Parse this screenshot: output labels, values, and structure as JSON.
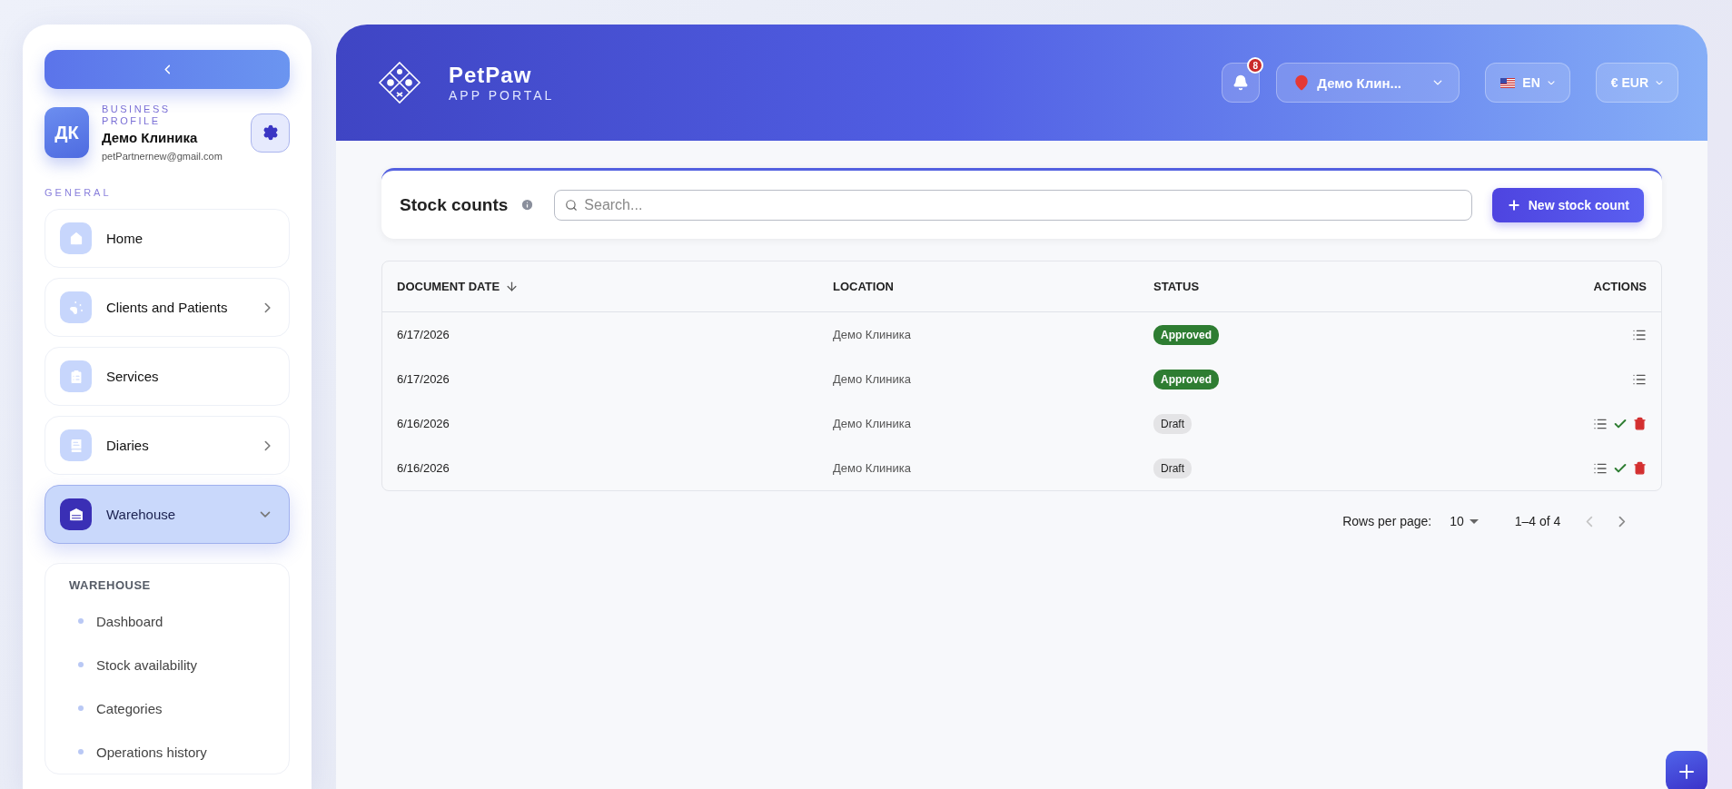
{
  "sidebar": {
    "profile": {
      "initials": "ДК",
      "caption": "BUSINESS PROFILE",
      "name": "Демо Клиника",
      "email": "petPartnernew@gmail.com"
    },
    "section_title": "GENERAL",
    "items": [
      {
        "label": "Home",
        "kind": "link",
        "selected": false
      },
      {
        "label": "Clients and Patients",
        "kind": "group",
        "expanded": false,
        "selected": false
      },
      {
        "label": "Services",
        "kind": "link",
        "selected": false
      },
      {
        "label": "Diaries",
        "kind": "group",
        "expanded": false,
        "selected": false
      },
      {
        "label": "Warehouse",
        "kind": "group",
        "expanded": true,
        "selected": true,
        "submenu_title": "WAREHOUSE",
        "children": [
          {
            "label": "Dashboard"
          },
          {
            "label": "Stock availability"
          },
          {
            "label": "Categories"
          },
          {
            "label": "Operations history"
          }
        ]
      }
    ]
  },
  "header": {
    "brand": "PetPaw",
    "subtitle": "APP PORTAL",
    "notifications": "8",
    "location": "Демо Клин...",
    "language": "EN",
    "currency": "€ EUR"
  },
  "toolbar": {
    "title": "Stock counts",
    "search": {
      "placeholder": "Search..."
    },
    "new_button": "New stock count"
  },
  "table": {
    "columns": [
      {
        "label": "DOCUMENT DATE",
        "sorted": true
      },
      {
        "label": "LOCATION",
        "sorted": false
      },
      {
        "label": "STATUS",
        "sorted": false
      },
      {
        "label": "ACTIONS",
        "sorted": false
      }
    ],
    "rows": [
      {
        "date": "6/17/2026",
        "location": "Демо Клиника",
        "status": {
          "label": "Approved",
          "kind": "approved"
        },
        "actions": [
          {
            "kind": "details"
          }
        ]
      },
      {
        "date": "6/17/2026",
        "location": "Демо Клиника",
        "status": {
          "label": "Approved",
          "kind": "approved"
        },
        "actions": [
          {
            "kind": "details"
          }
        ]
      },
      {
        "date": "6/16/2026",
        "location": "Демо Клиника",
        "status": {
          "label": "Draft",
          "kind": "draft"
        },
        "actions": [
          {
            "kind": "details"
          },
          {
            "kind": "approve"
          },
          {
            "kind": "delete"
          }
        ]
      },
      {
        "date": "6/16/2026",
        "location": "Демо Клиника",
        "status": {
          "label": "Draft",
          "kind": "draft"
        },
        "actions": [
          {
            "kind": "details"
          },
          {
            "kind": "approve"
          },
          {
            "kind": "delete"
          }
        ]
      }
    ]
  },
  "pagination": {
    "rows_label": "Rows per page:",
    "rows_value": "10",
    "range": "1–4 of 4",
    "prev_disabled": true,
    "next_disabled": false
  }
}
